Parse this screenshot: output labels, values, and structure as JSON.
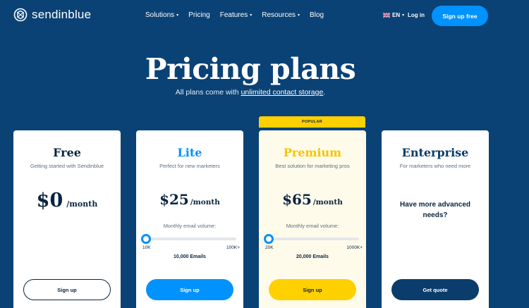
{
  "header": {
    "logo_text": "sendinblue",
    "nav": [
      {
        "label": "Solutions",
        "has_caret": true
      },
      {
        "label": "Pricing",
        "has_caret": false
      },
      {
        "label": "Features",
        "has_caret": true
      },
      {
        "label": "Resources",
        "has_caret": true
      },
      {
        "label": "Blog",
        "has_caret": false
      }
    ],
    "lang": "EN",
    "login": "Log in",
    "signup": "Sign up free"
  },
  "hero": {
    "title": "Pricing plans",
    "subtitle_prefix": "All plans come with ",
    "subtitle_link": "unlimited contact storage",
    "subtitle_suffix": "."
  },
  "popular_label": "POPULAR",
  "plans": [
    {
      "name": "Free",
      "desc": "Getting started with Sendinblue",
      "price": "$0",
      "per": "/month",
      "button": "Sign up"
    },
    {
      "name": "Lite",
      "desc": "Perfect for new marketers",
      "price": "$25",
      "per": "/month",
      "volume_label": "Monthly email volume:",
      "slider_min": "10K",
      "slider_max": "100K+",
      "slider_value": 0,
      "emails": "10,000 Emails",
      "button": "Sign up"
    },
    {
      "name": "Premium",
      "desc": "Best solution for marketing pros",
      "price": "$65",
      "per": "/month",
      "volume_label": "Monthly email volume:",
      "slider_min": "20K",
      "slider_max": "1000K+",
      "slider_value": 0,
      "emails": "20,000 Emails",
      "button": "Sign up"
    },
    {
      "name": "Enterprise",
      "desc": "For marketers who need more",
      "advanced": "Have more advanced needs?",
      "button": "Get quote"
    }
  ],
  "colors": {
    "background": "#0a4275",
    "accent_blue": "#0092ff",
    "accent_yellow": "#ffd000",
    "navy": "#0a3d6b"
  }
}
